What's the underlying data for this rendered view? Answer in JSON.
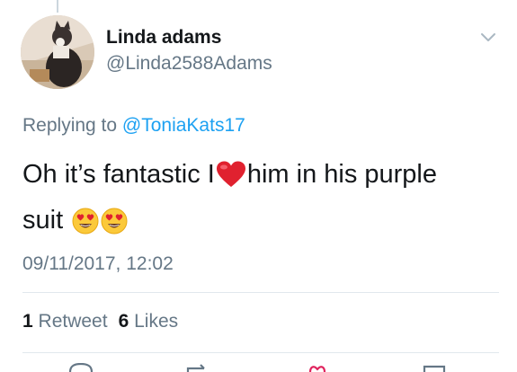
{
  "tweet": {
    "author_name": "Linda adams",
    "author_handle": "@Linda2588Adams",
    "replying_prefix": "Replying to",
    "replying_to": "@ToniaKats17",
    "text_part1": "Oh it’s fantastic I",
    "text_part2": "him in his purple",
    "text_part3": "suit",
    "timestamp": "09/11/2017, 12:02",
    "retweet_count": "1",
    "retweet_label": "Retweet",
    "like_count": "6",
    "like_label": "Likes"
  },
  "icons": {
    "menu": "chevron-down-icon",
    "inline_heart": "red-heart-emoji",
    "inline_emoji": "heart-eyes-emoji",
    "actions": [
      "reply-icon",
      "retweet-icon",
      "like-icon",
      "share-icon"
    ]
  },
  "colors": {
    "link": "#1da1f2",
    "secondary_text": "#657786",
    "primary_text": "#14171a",
    "heart": "#e0212f"
  }
}
